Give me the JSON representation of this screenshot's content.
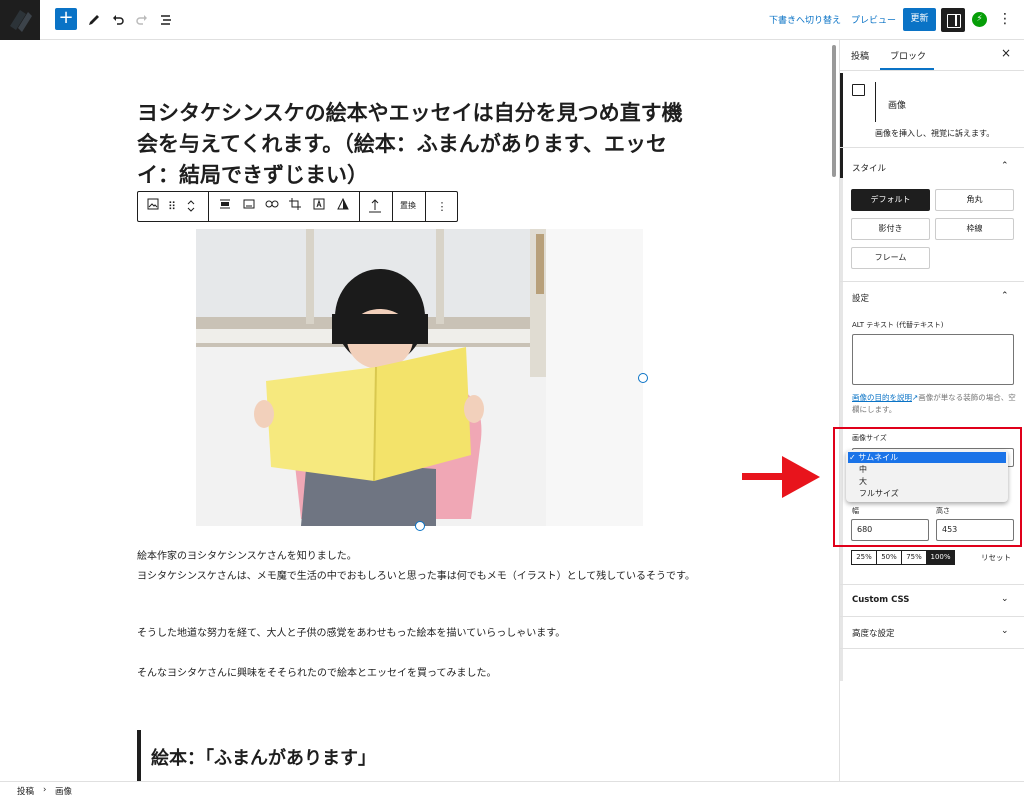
{
  "toolbar": {
    "add_label": "+",
    "switch_to_draft": "下書きへ切り替え",
    "preview": "プレビュー",
    "update": "更新",
    "jetpack_glyph": "⚡",
    "more_glyph": "⋮",
    "colors": {
      "accent": "#0a73c6",
      "jetpack": "#069e08"
    }
  },
  "editor": {
    "title": "ヨシタケシンスケの絵本やエッセイは自分を見つめ直す機会を与えてくれます。（絵本：ふまんがあります、エッセイ：結局できずじまい）",
    "block_toolbar": {
      "replace_label": "置換"
    },
    "paragraphs": [
      "絵本作家のヨシタケシンスケさんを知りました。",
      "ヨシタケシンスケさんは、メモ魔で生活の中でおもしろいと思った事は何でもメモ（イラスト）として残しているそうです。",
      "そうした地道な努力を経て、大人と子供の感覚をあわせもった絵本を描いていらっしゃいます。",
      "そんなヨシタケさんに興味をそそられたので絵本とエッセイを買ってみました。"
    ],
    "heading": "絵本：「ふまんがあります」"
  },
  "sidebar": {
    "tabs": [
      {
        "label": "投稿"
      },
      {
        "label": "ブロック"
      }
    ],
    "close_glyph": "×",
    "block_card": {
      "title": "画像",
      "description": "画像を挿入し、視覚に訴えます。"
    },
    "styles": {
      "title": "スタイル",
      "options": [
        {
          "label": "デフォルト",
          "active": true
        },
        {
          "label": "角丸"
        },
        {
          "label": "影付き"
        },
        {
          "label": "枠線"
        },
        {
          "label": "フレーム"
        }
      ]
    },
    "settings": {
      "title": "設定",
      "alt_label": "ALT テキスト (代替テキスト)",
      "alt_help_link": "画像の目的を説明",
      "alt_help_text": "画像が単なる装飾の場合、空欄にします。",
      "size_label": "画像サイズ",
      "size_options": [
        {
          "label": "サムネイル",
          "selected": true,
          "check": "✓"
        },
        {
          "label": "中"
        },
        {
          "label": "大"
        },
        {
          "label": "フルサイズ"
        }
      ],
      "width_label": "幅",
      "height_label": "高さ",
      "width_value": "680",
      "height_value": "453",
      "percent_buttons": [
        "25%",
        "50%",
        "75%",
        "100%"
      ],
      "percent_active": "100%",
      "reset_label": "リセット"
    },
    "custom_css": "Custom CSS",
    "advanced": "高度な設定"
  },
  "breadcrumb": {
    "items": [
      "投稿",
      "画像"
    ],
    "separator": "›"
  }
}
